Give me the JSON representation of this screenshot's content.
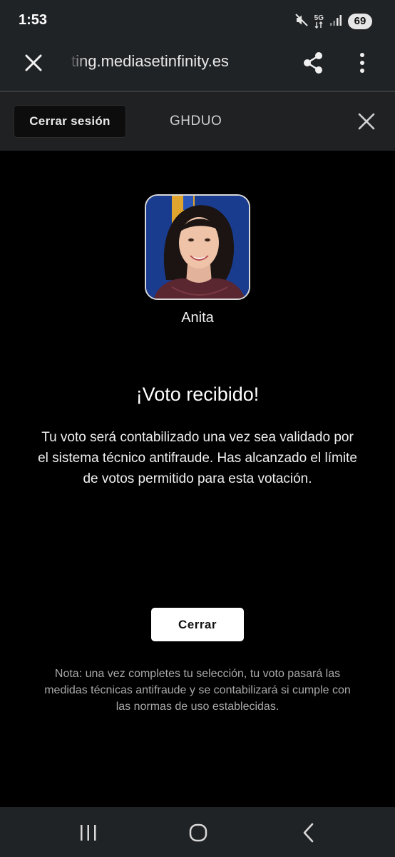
{
  "status_bar": {
    "time": "1:53",
    "network": "5G",
    "battery": "69",
    "icons": [
      "mute-icon",
      "network-icon",
      "signal-icon",
      "battery-icon"
    ]
  },
  "browser": {
    "url": "ting.mediasetinfinity.es",
    "icons": [
      "close-icon",
      "share-icon",
      "more-vert-icon"
    ]
  },
  "header": {
    "logout_label": "Cerrar sesión",
    "code": "GHDUO",
    "close_icon": "close-icon"
  },
  "candidate": {
    "name": "Anita"
  },
  "result": {
    "title": "¡Voto recibido!",
    "message": "Tu voto será contabilizado una vez sea validado por el sistema técnico antifraude. Has alcanzado el límite de votos permitido para esta votación.",
    "close_label": "Cerrar",
    "note": "Nota: una vez completes tu selección, tu voto pasará las medidas técnicas antifraude y se contabilizará si cumple con las normas de uso establecidas."
  },
  "nav": {
    "icons": [
      "recents-icon",
      "home-icon",
      "back-icon"
    ]
  },
  "colors": {
    "background": "#000000",
    "bars": "#202326",
    "photo_blue": "#1a3c8f",
    "photo_accent": "#e0a52e"
  }
}
